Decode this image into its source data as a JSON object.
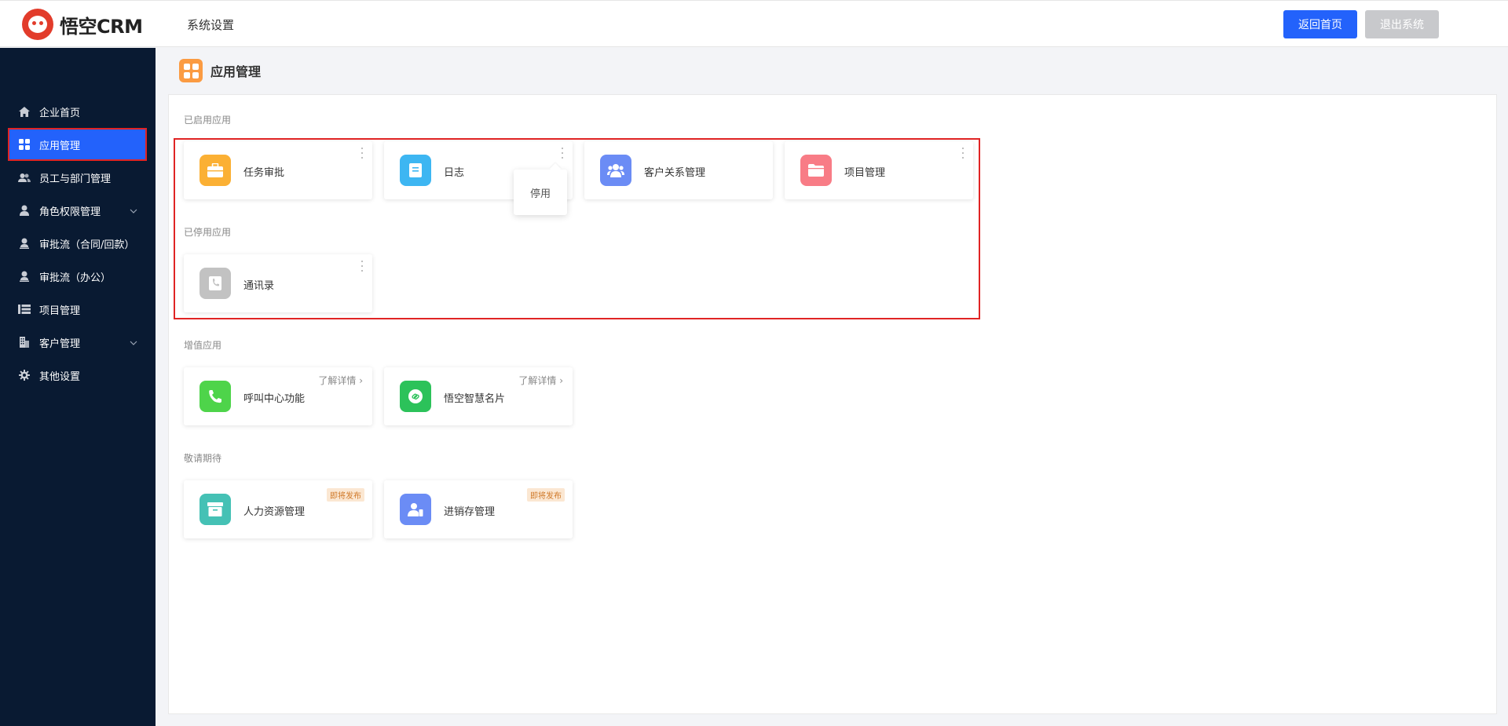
{
  "header": {
    "logo_text": "悟空CRM",
    "title": "系统设置",
    "home_button": "返回首页",
    "exit_button": "退出系统",
    "accent_color": "#2362fb"
  },
  "sidebar": {
    "items": [
      {
        "label": "企业首页",
        "icon": "home-icon"
      },
      {
        "label": "应用管理",
        "icon": "apps-grid-icon",
        "active": true
      },
      {
        "label": "员工与部门管理",
        "icon": "users-icon"
      },
      {
        "label": "角色权限管理",
        "icon": "user-icon",
        "expandable": true
      },
      {
        "label": "审批流（合同/回款）",
        "icon": "user-stamp-icon"
      },
      {
        "label": "审批流（办公）",
        "icon": "user-icon"
      },
      {
        "label": "项目管理",
        "icon": "list-icon"
      },
      {
        "label": "客户管理",
        "icon": "building-icon",
        "expandable": true
      },
      {
        "label": "其他设置",
        "icon": "gear-icon"
      }
    ],
    "collapse_icon": "menu-collapse-icon",
    "background": "#091a32"
  },
  "main": {
    "page_title": "应用管理",
    "sections": {
      "enabled": {
        "label": "已启用应用",
        "apps": [
          {
            "name": "任务审批",
            "icon": "briefcase-icon",
            "color": "#fbb034"
          },
          {
            "name": "日志",
            "icon": "document-icon",
            "color": "#3db6f2"
          },
          {
            "name": "客户关系管理",
            "icon": "contacts-icon",
            "color": "#6b8cf5"
          },
          {
            "name": "项目管理",
            "icon": "folder-icon",
            "color": "#f87c86"
          }
        ]
      },
      "disabled": {
        "label": "已停用应用",
        "apps": [
          {
            "name": "通讯录",
            "icon": "phonebook-icon",
            "color": "#c2c2c2"
          }
        ]
      },
      "value_added": {
        "label": "增值应用",
        "apps": [
          {
            "name": "呼叫中心功能",
            "icon": "phone-icon",
            "color": "#4ed44a",
            "detail": "了解详情"
          },
          {
            "name": "悟空智慧名片",
            "icon": "link-icon",
            "color": "#2cc25a",
            "detail": "了解详情"
          }
        ]
      },
      "coming_soon": {
        "label": "敬请期待",
        "apps": [
          {
            "name": "人力资源管理",
            "icon": "archive-icon",
            "color": "#45c1b5",
            "badge": "即将发布"
          },
          {
            "name": "进销存管理",
            "icon": "person-card-icon",
            "color": "#6b8cf5",
            "badge": "即将发布"
          }
        ]
      }
    },
    "popover": {
      "label": "停用"
    }
  }
}
